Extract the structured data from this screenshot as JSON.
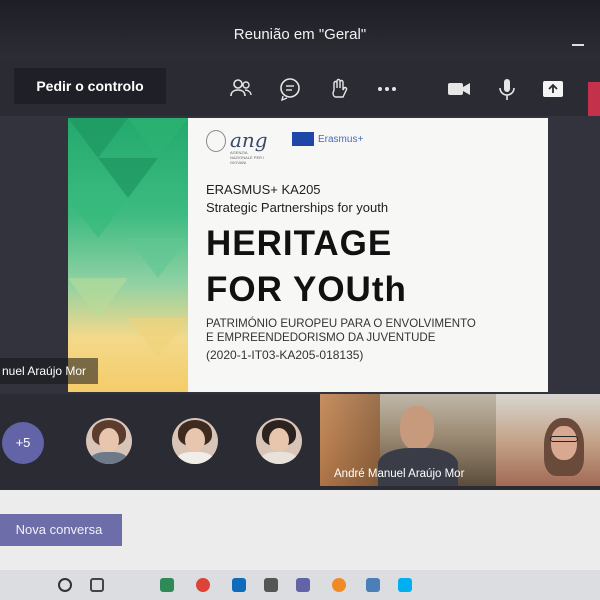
{
  "window": {
    "title": "Reunião em \"Geral\""
  },
  "toolbar": {
    "control_button": "Pedir o controlo",
    "icons": [
      "people-icon",
      "chat-icon",
      "raise-hand-icon",
      "more-icon",
      "camera-icon",
      "mic-icon",
      "share-icon"
    ],
    "accent": "#c4314b"
  },
  "slide": {
    "logo_ang": "ang",
    "logo_ang_sub": "AGENZIA NAZIONALE PER I GIOVANI",
    "logo_eu": "Erasmus+",
    "line1": "ERASMUS+ KA205",
    "line2": "Strategic Partnerships for youth",
    "heading1": "HERITAGE",
    "heading2": "FOR YOUth",
    "pt_line1": "PATRIMÓNIO EUROPEU PARA O ENVOLVIMENTO",
    "pt_line2": "E EMPREENDEDORISMO DA JUVENTUDE",
    "code": "(2020-1-IT03-KA205-018135)"
  },
  "presenter": {
    "label": "nuel Araújo Mor"
  },
  "roster": {
    "overflow_count": "+5",
    "video_label": "André Manuel Araújo Mor"
  },
  "chat": {
    "new_chat": "Nova conversa"
  },
  "colors": {
    "teams_purple": "#6264a7",
    "slide_green": "#23a96d"
  }
}
